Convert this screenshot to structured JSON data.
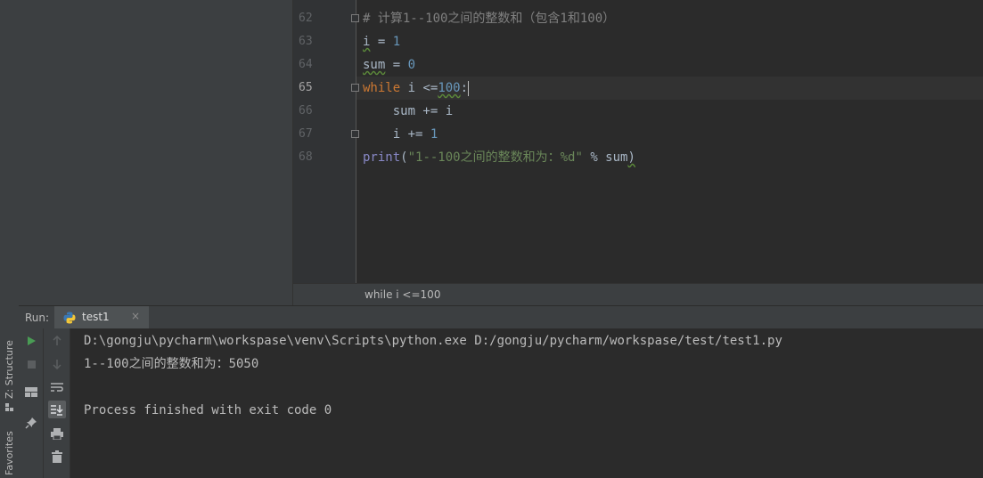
{
  "left_strip": {
    "structure_label": "Z: Structure",
    "favorites_label": "Favorites"
  },
  "editor": {
    "line_numbers": [
      "62",
      "63",
      "64",
      "65",
      "66",
      "67",
      "68"
    ],
    "current_line": "65",
    "code": {
      "l62_comment": "# 计算1--100之间的整数和（包含1和100）",
      "l63_var": "i",
      "l63_op": " = ",
      "l63_num": "1",
      "l64_var": "sum",
      "l64_op": " = ",
      "l64_num": "0",
      "l65_kw": "while",
      "l65_mid": " i <=",
      "l65_num": "100",
      "l65_colon": ":",
      "l66_text": "    sum += i",
      "l67_text": "    i += ",
      "l67_num": "1",
      "l68_fn": "print",
      "l68_open": "(",
      "l68_str": "\"1--100之间的整数和为：%d\"",
      "l68_rest": " % sum",
      "l68_close": ")"
    },
    "breadcrumb": "while i <=100"
  },
  "run": {
    "label": "Run:",
    "tab_label": "test1",
    "tab_close": "×",
    "console_lines": [
      "D:\\gongju\\pycharm\\workspase\\venv\\Scripts\\python.exe D:/gongju/pycharm/workspase/test/test1.py",
      "1--100之间的整数和为：5050",
      "",
      "Process finished with exit code 0"
    ]
  },
  "colors": {
    "keyword": "#cc7832",
    "number": "#6897bb",
    "string": "#6a8759",
    "comment": "#808080",
    "run_green": "#499c54"
  },
  "icons": [
    "rerun-icon",
    "stop-icon",
    "layout-icon",
    "pin-icon",
    "scroll-up-icon",
    "scroll-down-icon",
    "soft-wrap-icon",
    "scroll-to-end-icon",
    "print-icon",
    "trash-icon",
    "python-icon"
  ]
}
